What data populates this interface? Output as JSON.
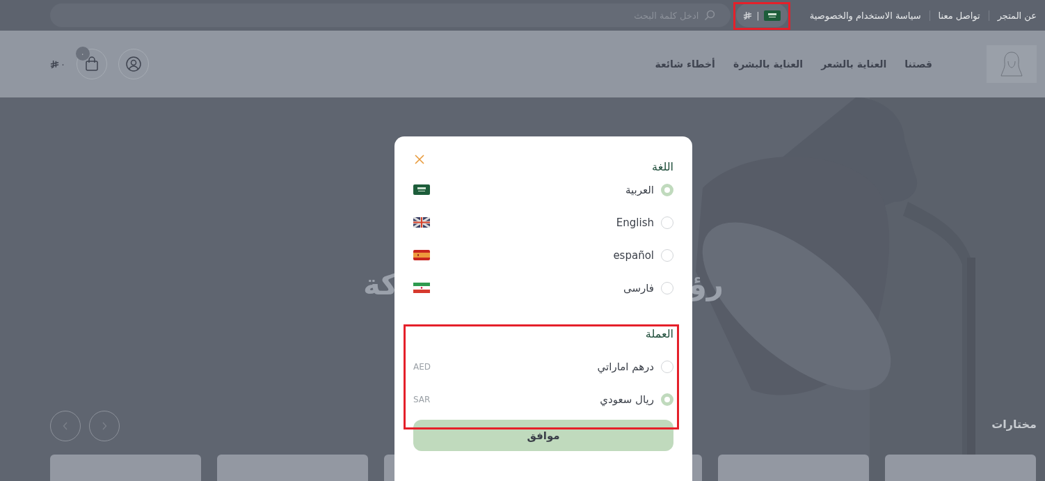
{
  "top_bar": {
    "links": [
      "عن المتجر",
      "تواصل معنا",
      "سياسة الاستخدام والخصوصية"
    ],
    "locale_switch": {
      "kind": "sa",
      "separator": "|"
    },
    "search": {
      "placeholder": "ادخل كلمة البحث"
    }
  },
  "header": {
    "nav": [
      "قصتنا",
      "العناية بالشعر",
      "العناية بالبشرة",
      "أخطاء شائعة"
    ],
    "cart_count": "٠",
    "total": "٠"
  },
  "hero": {
    "title_parts": [
      "رؤ",
      "كة"
    ],
    "section_title": "مختارات"
  },
  "modal": {
    "language": {
      "title": "اللغة",
      "options": [
        {
          "label": "العربية",
          "kind": "sa",
          "selected": true
        },
        {
          "label": "English",
          "kind": "gb",
          "selected": false
        },
        {
          "label": "español",
          "kind": "es",
          "selected": false
        },
        {
          "label": "فارسى",
          "kind": "ir",
          "selected": false
        }
      ]
    },
    "currency": {
      "title": "العملة",
      "options": [
        {
          "label": "درهم اماراتي",
          "code": "AED",
          "selected": false
        },
        {
          "label": "ريال سعودي",
          "code": "SAR",
          "selected": true
        }
      ]
    },
    "confirm_button": "موافق"
  }
}
